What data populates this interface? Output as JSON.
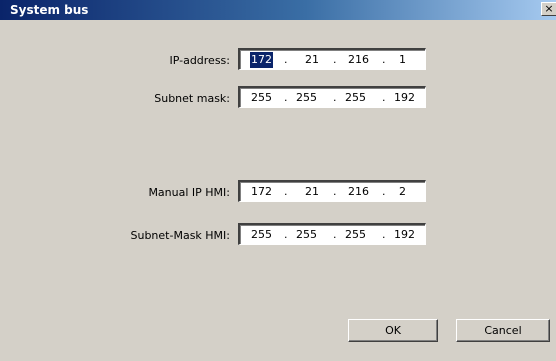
{
  "window": {
    "title": "System bus",
    "close_glyph": "×"
  },
  "fields": {
    "ip_address": {
      "label": "IP-address:",
      "octets": [
        "172",
        "21",
        "216",
        "1"
      ]
    },
    "subnet_mask": {
      "label": "Subnet mask:",
      "octets": [
        "255",
        "255",
        "255",
        "192"
      ]
    },
    "manual_ip_hmi": {
      "label": "Manual IP HMI:",
      "octets": [
        "172",
        "21",
        "216",
        "2"
      ]
    },
    "subnet_mask_hmi": {
      "label": "Subnet-Mask HMI:",
      "octets": [
        "255",
        "255",
        "255",
        "192"
      ]
    }
  },
  "buttons": {
    "ok": "OK",
    "cancel": "Cancel"
  },
  "colors": {
    "face": "#d4d0c8",
    "title_start": "#0a246a",
    "title_end": "#a6caf0",
    "selection": "#0a246a"
  }
}
